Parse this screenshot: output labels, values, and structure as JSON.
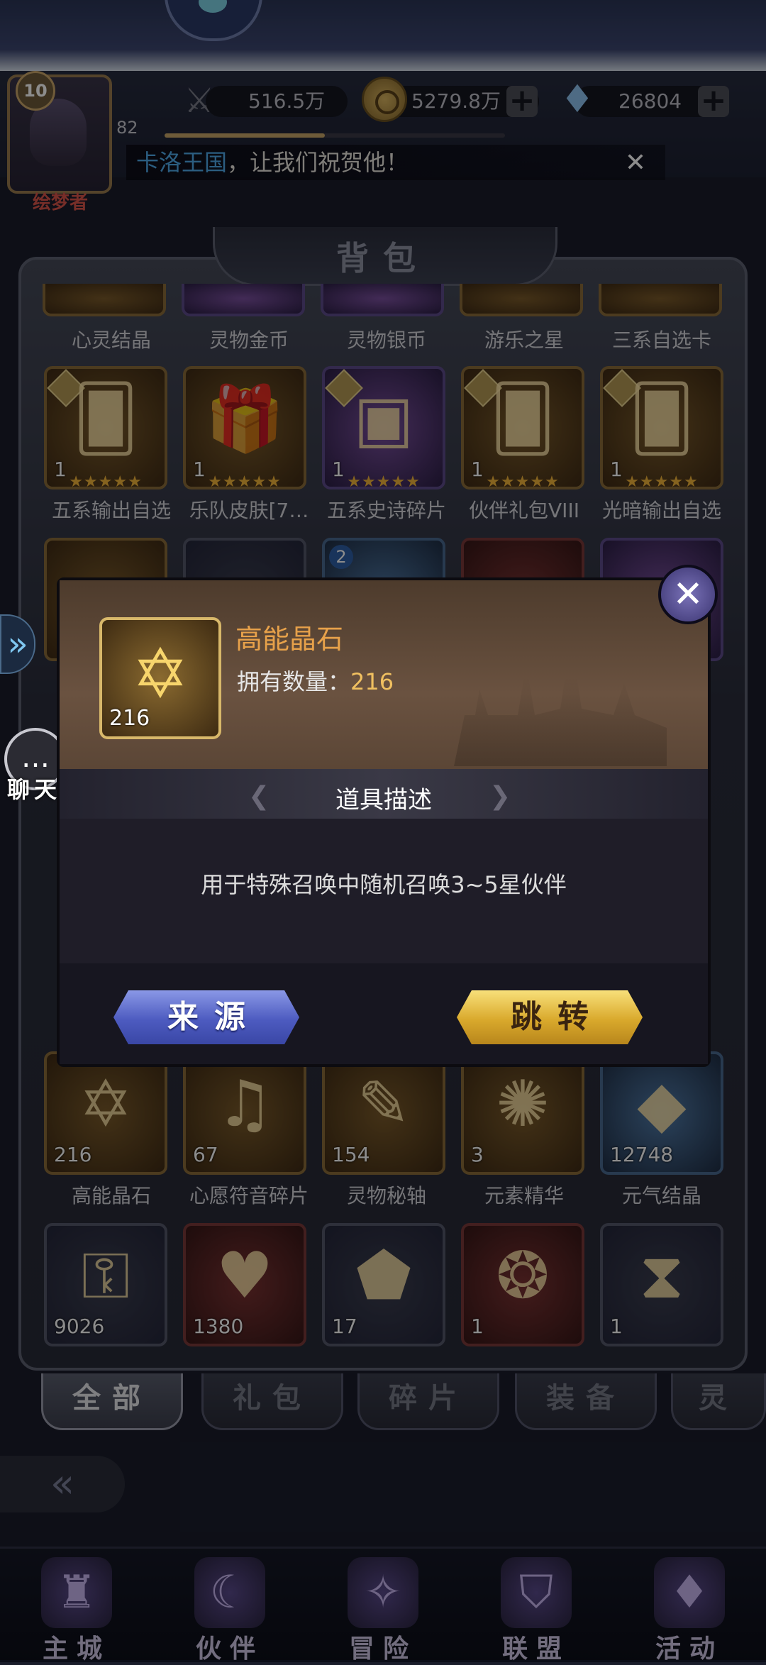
{
  "header": {
    "player_level": "82",
    "avatar_level": "10",
    "exp_fraction": 0.47,
    "title_badge": "绘梦者",
    "power": "516.5万",
    "gold": "5279.8万",
    "gems": "26804",
    "plus_symbol": "+",
    "marquee_highlight": "卡洛王国",
    "marquee_text": "，让我们祝贺他！",
    "marquee_close": "✕"
  },
  "panel": {
    "title": "背包",
    "row1_names": [
      "心灵结晶",
      "灵物金币",
      "灵物银币",
      "游乐之星",
      "三系自选卡"
    ],
    "row2": [
      {
        "name": "五系输出自选",
        "count": "1",
        "stars": "★★★★★",
        "icon": "card-icon"
      },
      {
        "name": "乐队皮肤[7…",
        "count": "1",
        "stars": "★★★★★",
        "icon": "gift-box-icon"
      },
      {
        "name": "五系史诗碎片",
        "count": "1",
        "stars": "★★★★★",
        "icon": "treasure-chest-icon"
      },
      {
        "name": "伙伴礼包VIII",
        "count": "1",
        "stars": "★★★★★",
        "icon": "card-icon"
      },
      {
        "name": "光暗输出自选",
        "count": "1",
        "stars": "★★★★★",
        "icon": "card-icon"
      }
    ],
    "row_bottom": [
      {
        "name": "高能晶石",
        "count": "216"
      },
      {
        "name": "心愿符音碎片",
        "count": "67"
      },
      {
        "name": "灵物秘轴",
        "count": "154"
      },
      {
        "name": "元素精华",
        "count": "3"
      },
      {
        "name": "元气结晶",
        "count": "12748"
      }
    ],
    "row_last": [
      {
        "count": "9026"
      },
      {
        "count": "1380"
      },
      {
        "count": "17"
      },
      {
        "count": "1"
      },
      {
        "count": "1"
      }
    ],
    "hidden_row_badge": "2"
  },
  "tabs": [
    "全部",
    "礼包",
    "碎片",
    "装备",
    "灵"
  ],
  "side": {
    "chat_label": "聊天",
    "chat_icon": "…",
    "side_arrow": "»",
    "back_arrow": "«"
  },
  "nav": [
    "主城",
    "伙伴",
    "冒险",
    "联盟",
    "活动"
  ],
  "dialog": {
    "item_name": "高能晶石",
    "owned_label": "拥有数量：",
    "owned_count": "216",
    "item_count": "216",
    "desc_title": "道具描述",
    "description": "用于特殊召唤中随机召唤3~5星伙伴",
    "btn_source": "来源",
    "btn_jump": "跳转",
    "close": "✕"
  }
}
